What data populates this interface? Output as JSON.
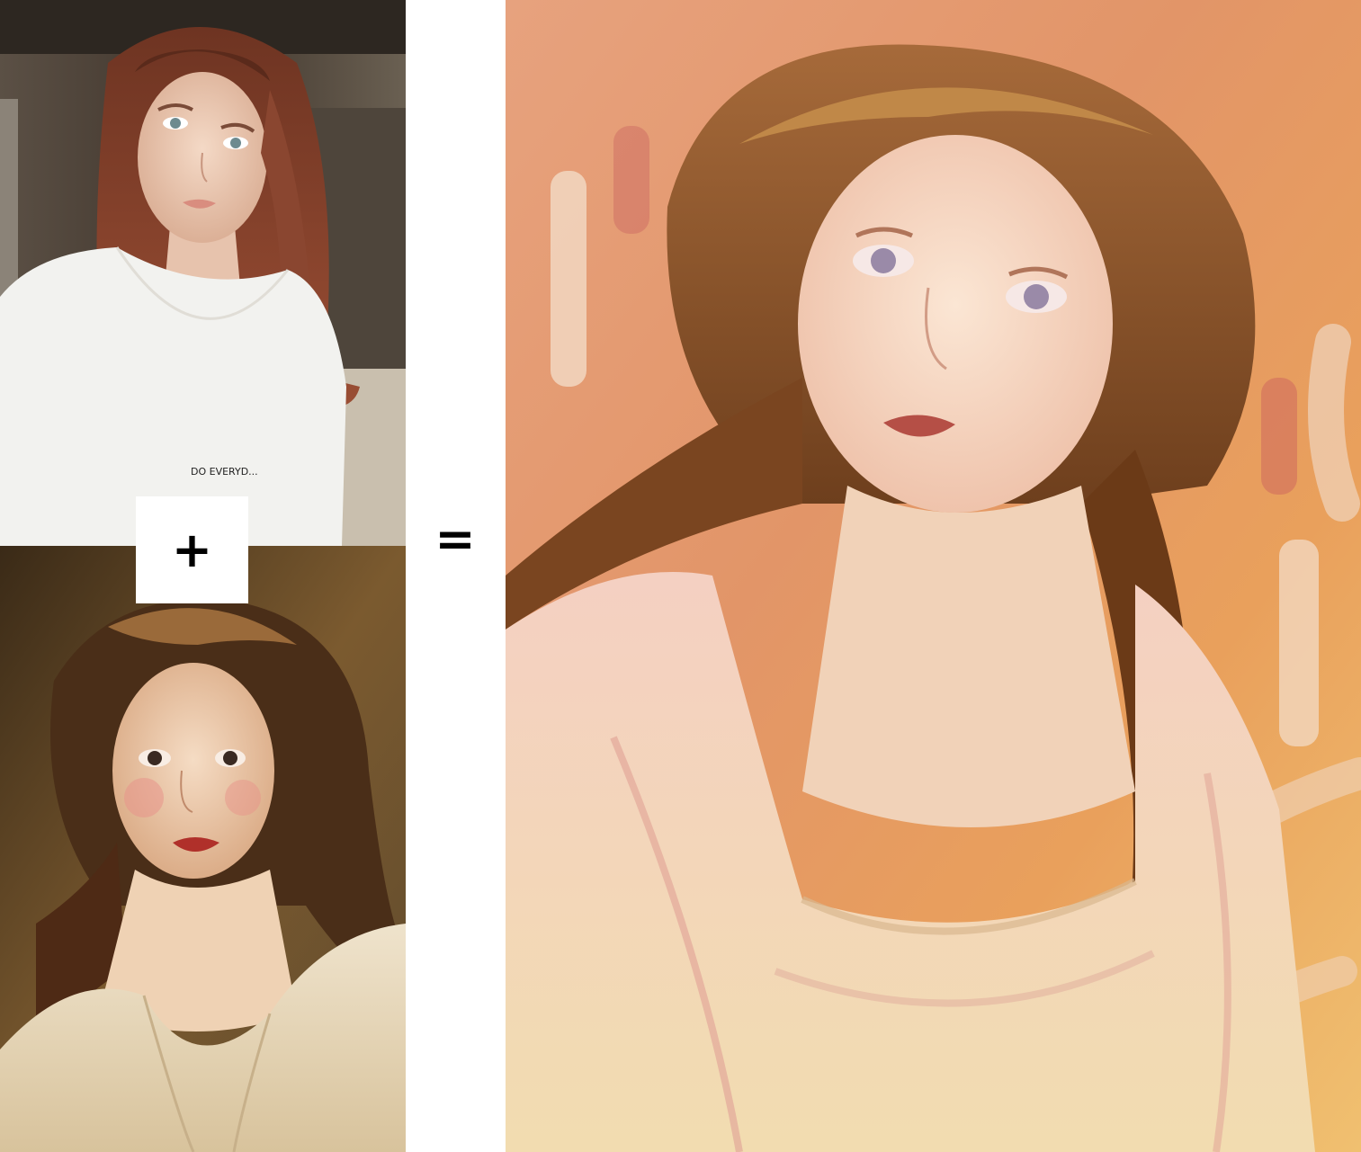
{
  "panels": {
    "photo": {
      "description_id": "reference-photo"
    },
    "painting": {
      "description_id": "original-painting"
    },
    "result": {
      "description_id": "digital-painting"
    }
  },
  "operators": {
    "plus": "+",
    "equals": "="
  },
  "shirt_text": "DO EVERYD...",
  "colors": {
    "background": "#ffffff",
    "operator": "#000000"
  }
}
